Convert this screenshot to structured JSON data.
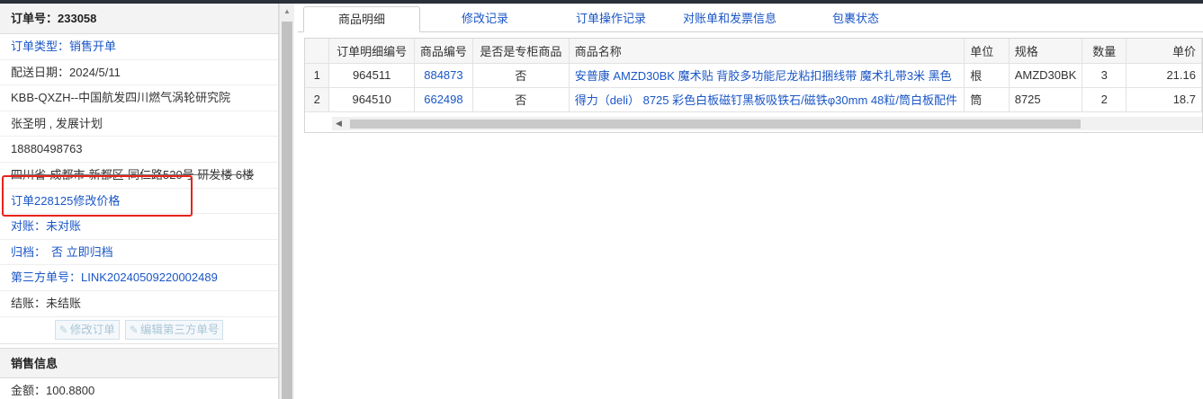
{
  "order": {
    "header": "订单号：233058",
    "fields": [
      {
        "label": "订单类型：",
        "value": "销售开单",
        "link": true
      },
      {
        "label": "配送日期：",
        "value": "2024/5/11",
        "link": false
      },
      {
        "label": "",
        "value": "KBB-QXZH--中国航发四川燃气涡轮研究院",
        "link": false
      },
      {
        "label": "",
        "value": "张圣明 , 发展计划",
        "link": false
      },
      {
        "label": "",
        "value": "18880498763",
        "link": false
      },
      {
        "label": "",
        "value": "四川省-成都市-新都区-同仁路520号 研发楼 6楼",
        "link": false,
        "strike": true
      },
      {
        "label": "",
        "value": "订单228125修改价格",
        "link": true
      },
      {
        "label": "对账：",
        "value": "未对账",
        "link": true
      },
      {
        "label": "归档：",
        "value": "否 立即归档",
        "link": true
      },
      {
        "label": "第三方单号：",
        "value": "LINK20240509220002489",
        "link": true
      },
      {
        "label": "结账：",
        "value": "未结账",
        "link": false
      }
    ],
    "buttons": {
      "edit_order": "修改订单",
      "edit_third_party": "编辑第三方单号"
    }
  },
  "sales": {
    "header": "销售信息",
    "amount_label": "金额：",
    "amount_value": "100.8800"
  },
  "tabs": [
    "商品明细",
    "修改记录",
    "订单操作记录",
    "对账单和发票信息",
    "包裹状态"
  ],
  "active_tab": "商品明细",
  "table": {
    "columns": [
      "",
      "订单明细编号",
      "商品编号",
      "是否是专柜商品",
      "商品名称",
      "单位",
      "规格",
      "数量",
      "单价"
    ],
    "rows": [
      {
        "n": "1",
        "detail_id": "964511",
        "product_id": "884873",
        "is_counter": "否",
        "name": "安普康 AMZD30BK 魔术贴 背胶多功能尼龙粘扣捆线带 魔术扎带3米 黑色",
        "unit": "根",
        "spec": "AMZD30BK",
        "qty": "3",
        "price": "21.16"
      },
      {
        "n": "2",
        "detail_id": "964510",
        "product_id": "662498",
        "is_counter": "否",
        "name": "得力（deli） 8725 彩色白板磁钉黑板吸铁石/磁铁φ30mm 48粒/筒白板配件",
        "unit": "筒",
        "spec": "8725",
        "qty": "2",
        "price": "18.7"
      }
    ]
  },
  "colors": {
    "link": "#1a56c6",
    "highlight": "#e8231b",
    "header_bg": "#f3f3f3"
  }
}
